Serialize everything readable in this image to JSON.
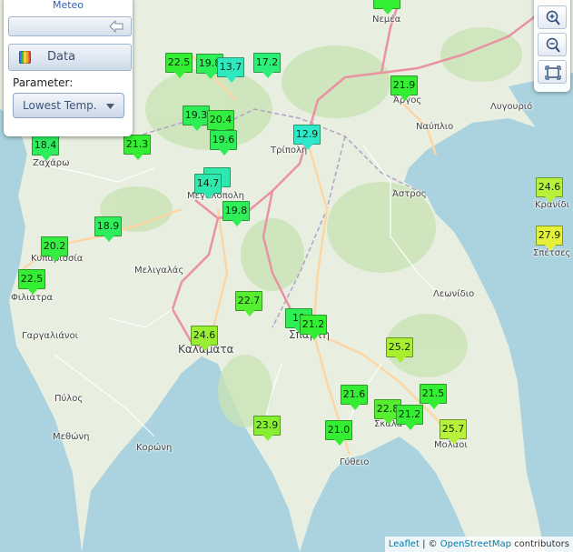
{
  "panel": {
    "title": "Meteo",
    "data_button_label": "Data",
    "parameter_label": "Parameter:",
    "parameter_value": "Lowest Temp."
  },
  "zoom": {
    "zoom_in": "+",
    "zoom_out": "−"
  },
  "colors": {
    "water": "#aad3df",
    "land": "#e9efe0",
    "forest": "#c9e3b5",
    "motorway": "#e892a2",
    "primary": "#fcd6a4",
    "border": "#b2a0c8"
  },
  "places": [
    {
      "id": "nemea",
      "text": "Νεμέα"
    },
    {
      "id": "argos",
      "text": "Άργος"
    },
    {
      "id": "lygourio",
      "text": "Λυγουριό"
    },
    {
      "id": "nafplio",
      "text": "Ναύπλιο"
    },
    {
      "id": "zacharo",
      "text": "Ζαχάρω"
    },
    {
      "id": "tripoli",
      "text": "Τρίπολη"
    },
    {
      "id": "megalopoli",
      "text": "Μεγαλόπολη"
    },
    {
      "id": "astros",
      "text": "Άστρος"
    },
    {
      "id": "kranidi",
      "text": "Κρανίδι"
    },
    {
      "id": "kyparissia",
      "text": "Κυπαρισσία"
    },
    {
      "id": "meligalas",
      "text": "Μελιγαλάς"
    },
    {
      "id": "spetses",
      "text": "Σπέτσες"
    },
    {
      "id": "filiatra",
      "text": "Φιλιάτρα"
    },
    {
      "id": "leonidio",
      "text": "Λεωνίδιο"
    },
    {
      "id": "gargalianoi",
      "text": "Γαργαλιάνοι"
    },
    {
      "id": "kalamata",
      "text": "Καλαματα"
    },
    {
      "id": "sparti",
      "text": "Σπάρτη"
    },
    {
      "id": "pylos",
      "text": "Πύλος"
    },
    {
      "id": "skala",
      "text": "Σκάλα"
    },
    {
      "id": "methoni",
      "text": "Μεθώνη"
    },
    {
      "id": "koroni",
      "text": "Κορώνη"
    },
    {
      "id": "molaoi",
      "text": "Μολάοι"
    },
    {
      "id": "gytheio",
      "text": "Γύθειο"
    }
  ],
  "markers": [
    {
      "value": "22.5",
      "color": "#33ee33"
    },
    {
      "value": "19.8",
      "color": "#2eee5a"
    },
    {
      "value": "13.7",
      "color": "#2ee8c0"
    },
    {
      "value": "17.2",
      "color": "#2eee7a"
    },
    {
      "value": "21.9",
      "color": "#33ee33"
    },
    {
      "value": "18.4",
      "color": "#2eee60"
    },
    {
      "value": "21.3",
      "color": "#33ee33"
    },
    {
      "value": "19.3",
      "color": "#2eee55"
    },
    {
      "value": "20.4",
      "color": "#33ee40"
    },
    {
      "value": "19.6",
      "color": "#2eee55"
    },
    {
      "value": "12.9",
      "color": "#2ee8cc"
    },
    {
      "value": "14.7",
      "color": "#2ee8b0"
    },
    {
      "value": "19.8",
      "color": "#2eee5a"
    },
    {
      "value": "24.6",
      "color": "#b8f03a"
    },
    {
      "value": "27.9",
      "color": "#e6f03a"
    },
    {
      "value": "18.9",
      "color": "#2eee5c"
    },
    {
      "value": "20.2",
      "color": "#33ee40"
    },
    {
      "value": "22.5",
      "color": "#33ee33"
    },
    {
      "value": "22.7",
      "color": "#55ee30"
    },
    {
      "value": "19",
      "color": "#2eee55"
    },
    {
      "value": "21.2",
      "color": "#33ee33"
    },
    {
      "value": "24.6",
      "color": "#99ee30"
    },
    {
      "value": "25.2",
      "color": "#aaee30"
    },
    {
      "value": "21.6",
      "color": "#33ee33"
    },
    {
      "value": "21.5",
      "color": "#33ee33"
    },
    {
      "value": "22.8",
      "color": "#55ee30"
    },
    {
      "value": "21.2",
      "color": "#33ee33"
    },
    {
      "value": "23.9",
      "color": "#88ee30"
    },
    {
      "value": "21.0",
      "color": "#33ee33"
    },
    {
      "value": "25.7",
      "color": "#b8f03a"
    }
  ],
  "attribution": {
    "leaflet": "Leaflet",
    "sep": " | © ",
    "osm": "OpenStreetMap",
    "contrib": " contributors"
  }
}
